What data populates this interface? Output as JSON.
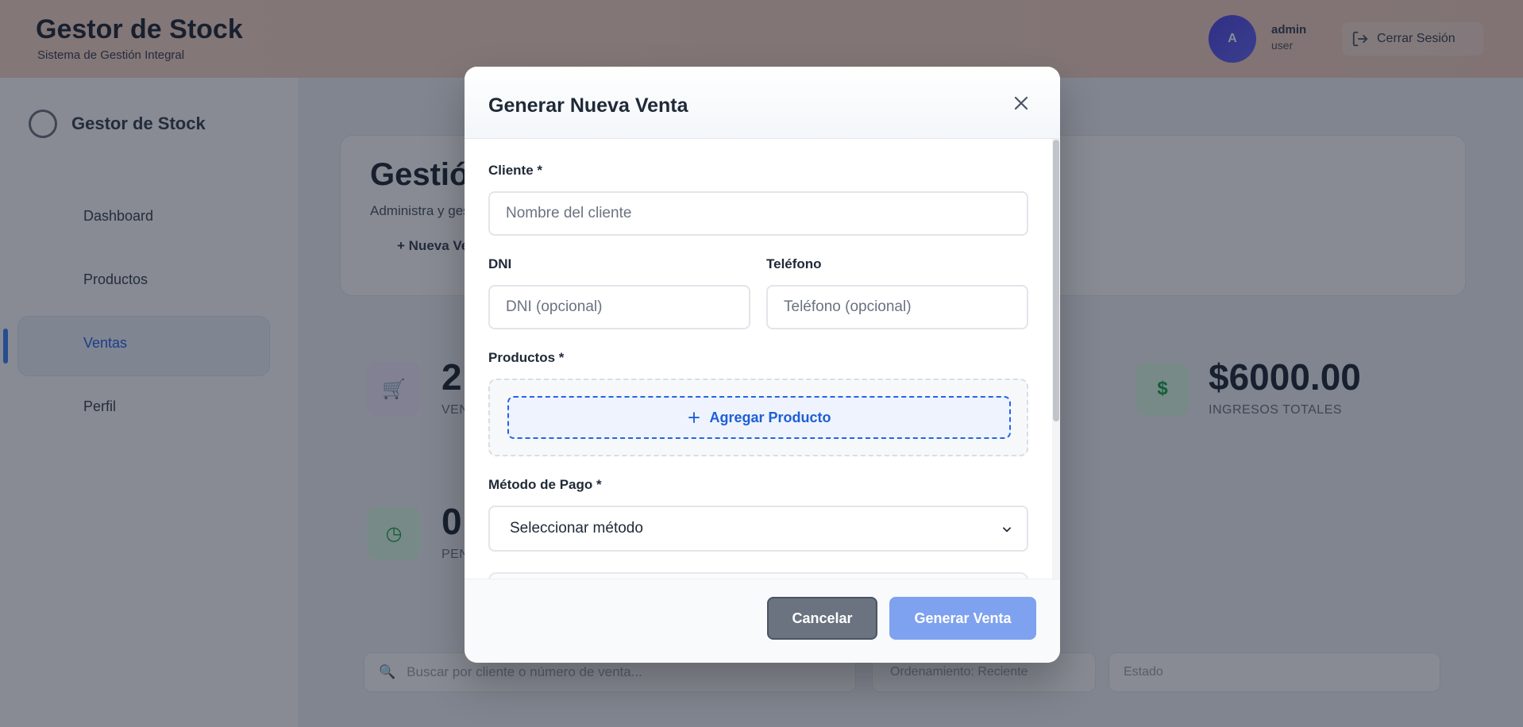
{
  "app": {
    "title": "Gestor de Stock",
    "subtitle": "Sistema de Gestión Integral",
    "user": {
      "initial": "A",
      "name": "admin",
      "role": "user"
    },
    "logout_label": "Cerrar Sesión"
  },
  "sidebar": {
    "logo_label": "Gestor de Stock",
    "items": [
      {
        "label": "Dashboard",
        "icon": "dashboard-icon"
      },
      {
        "label": "Productos",
        "icon": "box-icon"
      },
      {
        "label": "Ventas",
        "icon": "cart-icon",
        "active": true
      },
      {
        "label": "Perfil",
        "icon": "user-icon"
      }
    ]
  },
  "main": {
    "title": "Gestión de Ventas",
    "subtitle": "Administra y gestiona tus ventas",
    "new_sale_label": "Nueva Venta",
    "stats": [
      {
        "value": "2",
        "label": "VENTAS TOTALES",
        "icon": "cart-icon"
      },
      {
        "value": "$6000.00",
        "label": "INGRESOS TOTALES",
        "icon": "dollar-icon"
      },
      {
        "value": "0",
        "label": "PENDIENTES",
        "icon": "clock-icon"
      }
    ],
    "search_placeholder": "Buscar por cliente o número de venta...",
    "sort_label": "Ordenamiento: Reciente",
    "state_label": "Estado"
  },
  "modal": {
    "title": "Generar Nueva Venta",
    "fields": {
      "cliente_label": "Cliente *",
      "cliente_placeholder": "Nombre del cliente",
      "dni_label": "DNI",
      "dni_placeholder": "DNI (opcional)",
      "telefono_label": "Teléfono",
      "telefono_placeholder": "Teléfono (opcional)",
      "productos_label": "Productos *",
      "add_product_label": "Agregar Producto",
      "metodo_label": "Método de Pago *",
      "metodo_selected": "Seleccionar método"
    },
    "buttons": {
      "cancel": "Cancelar",
      "submit": "Generar Venta"
    }
  },
  "colors": {
    "primary": "#2563eb",
    "submit_disabled": "#7ea2ef",
    "cancel": "#6b7280",
    "header_gradient": "#f6d7c9"
  }
}
